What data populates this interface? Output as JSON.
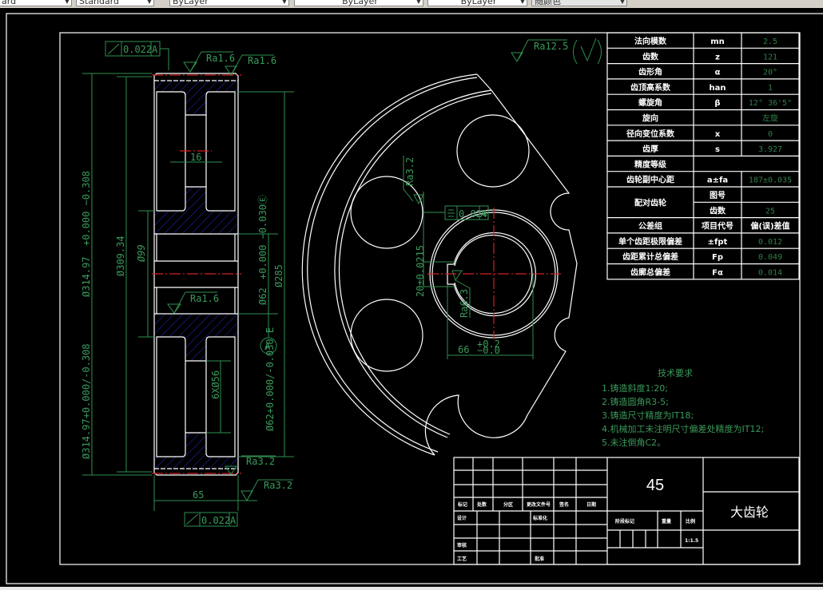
{
  "toolbar": {
    "dropdowns": [
      "ard",
      "Standard",
      "ByLayer",
      "ByLayer",
      "ByLayer",
      "随颜色"
    ]
  },
  "colors": {
    "dimension": "#2f8f4f",
    "centerline": "#d02020",
    "hatch": "#2828c8",
    "outline": "#ffffff"
  },
  "side_view": {
    "dims": {
      "od": "Ø314.97+0.000/-0.308",
      "od_main": "Ø314.97",
      "od_tol": "+0.000 −0.308",
      "pitch": "Ø309.34",
      "hub": "Ø99",
      "bore": "Ø62+0.000/-0.030 E",
      "bore_main": "Ø62",
      "bore_tol": "+0.000 −0.030Ⓔ",
      "root": "Ø285",
      "web": "16",
      "holes": "6XØ56",
      "width": "65"
    },
    "runout_top": {
      "value": "0.022",
      "datum": "A"
    },
    "runout_bottom": {
      "value": "0.022",
      "datum": "A"
    },
    "datum": "A",
    "roughness": [
      "Ra1.6",
      "Ra1.6",
      "Ra1.6",
      "Ra3.2",
      "Ra3.2"
    ]
  },
  "front_view": {
    "general_roughness": "Ra12.5",
    "roughness": [
      "Ra3.2",
      "Ra6.3"
    ],
    "symmetry": {
      "value": "0.024",
      "datum": "A"
    },
    "keyway_width": "20±0.0215",
    "keyway_depth": "66",
    "keyway_depth_tol_upper": "+0.2",
    "keyway_depth_tol_lower": "−0.0"
  },
  "params_table": {
    "rows": [
      {
        "name": "法向模数",
        "sym": "mn",
        "val": "2.5"
      },
      {
        "name": "齿数",
        "sym": "z",
        "val": "121"
      },
      {
        "name": "齿形角",
        "sym": "α",
        "val": "20°"
      },
      {
        "name": "齿顶高系数",
        "sym": "han",
        "val": "1"
      },
      {
        "name": "螺旋角",
        "sym": "β",
        "val": "12° 36'5\""
      },
      {
        "name": "旋向",
        "sym": "",
        "val": "左旋"
      },
      {
        "name": "径向变位系数",
        "sym": "x",
        "val": "0"
      },
      {
        "name": "齿厚",
        "sym": "s",
        "val": "3.927"
      },
      {
        "name": "精度等级",
        "sym": "",
        "val": ""
      },
      {
        "name": "齿轮副中心距",
        "sym": "a±fa",
        "val": "187±0.035"
      }
    ],
    "mate": {
      "name": "配对齿轮",
      "drawing_no_label": "图号",
      "drawing_no": "",
      "teeth_label": "齿数",
      "teeth": "25"
    },
    "tol_header": {
      "name": "公差组",
      "sym": "项目代号",
      "val": "偏(误)差值"
    },
    "tol_rows": [
      {
        "name": "单个齿距极限偏差",
        "sym": "±fpt",
        "val": "0.012"
      },
      {
        "name": "齿距累计总偏差",
        "sym": "Fp",
        "val": "0.049"
      },
      {
        "name": "齿廓总偏差",
        "sym": "Fα",
        "val": "0.014"
      }
    ]
  },
  "tech_requirements": {
    "title": "技术要求",
    "items": [
      "1.铸造斜度1:20;",
      "2.铸造圆角R3-5;",
      "3.铸造尺寸精度为IT18;",
      "4.机械加工未注明尺寸偏差处精度为IT12;",
      "5.未注倒角C2。"
    ]
  },
  "title_block": {
    "material": "45",
    "part_name": "大齿轮",
    "labels": {
      "mark": "标记",
      "count": "处数",
      "zone": "分区",
      "change_doc": "更改文件号",
      "sign": "签名",
      "date": "日期",
      "design": "设计",
      "standardize": "标准化",
      "review": "审核",
      "process": "工艺",
      "approve": "批准",
      "stage": "阶段标记",
      "weight": "重量",
      "scale": "比例"
    },
    "scale": "1:1.5"
  }
}
